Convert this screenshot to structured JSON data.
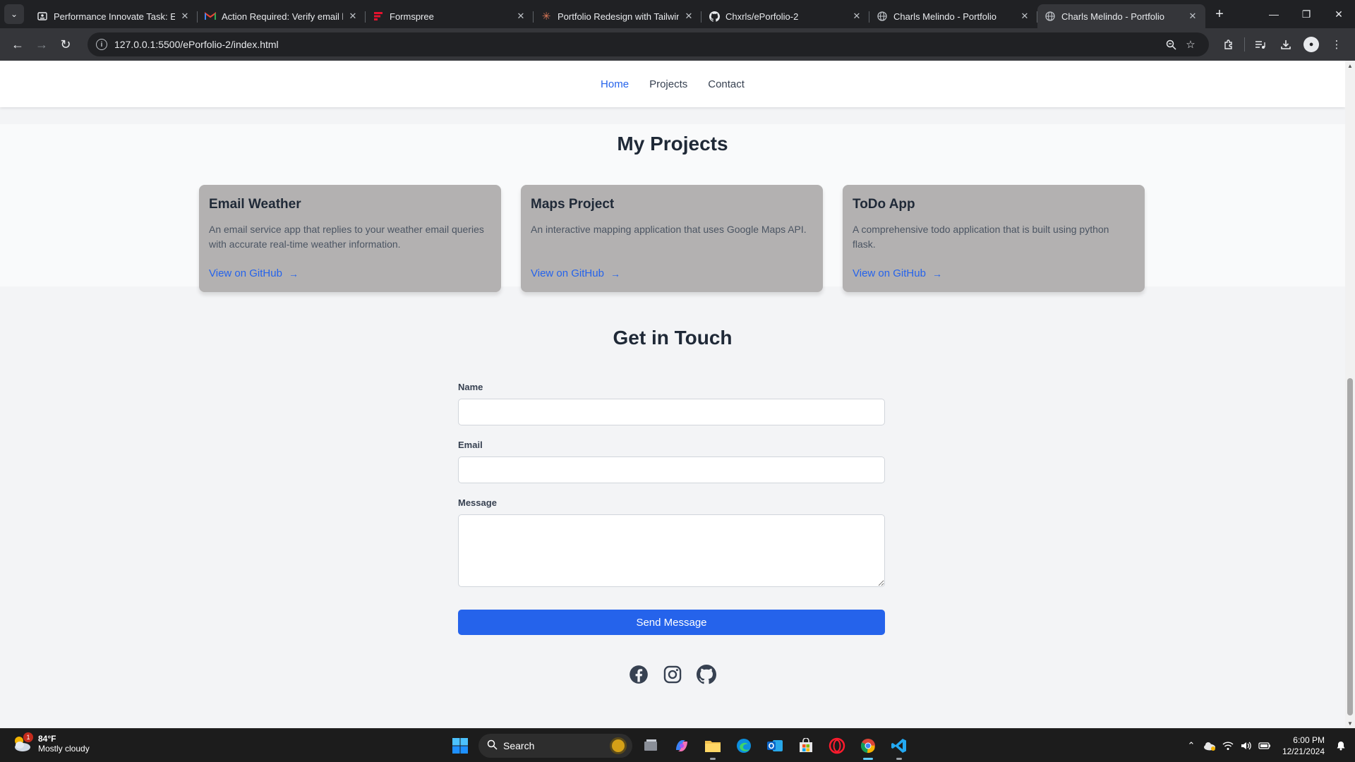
{
  "browser": {
    "tabs": [
      {
        "title": "Performance Innovate Task: Epc",
        "favicon": "portrait-icon"
      },
      {
        "title": "Action Required: Verify email lin",
        "favicon": "gmail-icon"
      },
      {
        "title": "Formspree",
        "favicon": "formspree-icon"
      },
      {
        "title": "Portfolio Redesign with Tailwinc",
        "favicon": "claude-icon"
      },
      {
        "title": "Chxrls/ePorfolio-2",
        "favicon": "github-icon"
      },
      {
        "title": "Charls Melindo - Portfolio",
        "favicon": "globe-icon"
      },
      {
        "title": "Charls Melindo - Portfolio",
        "favicon": "globe-icon"
      }
    ],
    "url": "127.0.0.1:5500/ePorfolio-2/index.html",
    "colors": {
      "frame": "#202124",
      "toolbar": "#35363a"
    }
  },
  "site": {
    "nav": {
      "home": "Home",
      "projects": "Projects",
      "contact": "Contact"
    },
    "projects": {
      "title": "My Projects",
      "items": [
        {
          "title": "Email Weather",
          "description": "An email service app that replies to your weather email queries with accurate real-time weather information.",
          "link": "View on GitHub"
        },
        {
          "title": "Maps Project",
          "description": "An interactive mapping application that uses Google Maps API.",
          "link": "View on GitHub"
        },
        {
          "title": "ToDo App",
          "description": "A comprehensive todo application that is built using python flask.",
          "link": "View on GitHub"
        }
      ]
    },
    "contact": {
      "title": "Get in Touch",
      "name_label": "Name",
      "name_value": "",
      "email_label": "Email",
      "email_value": "",
      "message_label": "Message",
      "message_value": "",
      "submit": "Send Message"
    },
    "socials": [
      "facebook-icon",
      "instagram-icon",
      "github-icon"
    ],
    "colors": {
      "accent": "#2563eb",
      "card": "#b3b1b1"
    }
  },
  "taskbar": {
    "weather": {
      "temp": "84°F",
      "desc": "Mostly cloudy",
      "badge": "1"
    },
    "search_label": "Search",
    "time": "6:00 PM",
    "date": "12/21/2024"
  }
}
